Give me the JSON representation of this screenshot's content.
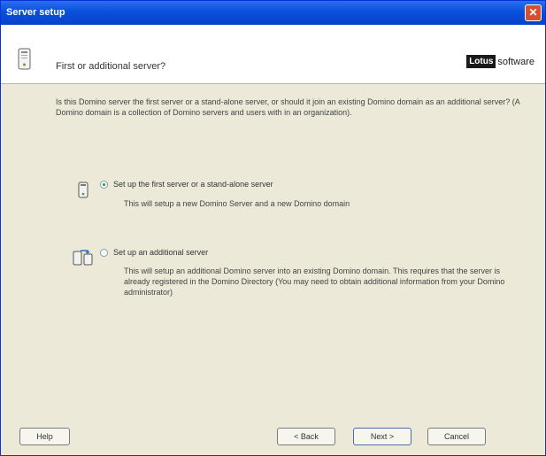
{
  "window": {
    "title": "Server setup"
  },
  "header": {
    "title": "First or additional server?",
    "brand_lotus": "Lotus",
    "brand_software": "software"
  },
  "intro": {
    "text": "Is this Domino server the first server or a stand-alone server, or should it join an existing Domino domain as an additional server? (A Domino domain is a collection of Domino servers and users with in an organization)."
  },
  "options": [
    {
      "label": "Set up the first server or a stand-alone server",
      "description": "This will setup a new Domino Server and a new Domino domain",
      "checked": true,
      "icon": "single-server-icon"
    },
    {
      "label": "Set up an additional server",
      "description": "This will setup an additional Domino server into an existing Domino domain. This requires that the server is already registered in the Domino Directory (You may need to obtain additional information from your Domino administrator)",
      "checked": false,
      "icon": "additional-server-icon"
    }
  ],
  "buttons": {
    "help": "Help",
    "back": "< Back",
    "next": "Next >",
    "cancel": "Cancel"
  },
  "colors": {
    "titlebar": "#0a4fdc",
    "dialog_bg": "#ece9d8",
    "close_button": "#d6502f",
    "radio_checked": "#21a121"
  }
}
